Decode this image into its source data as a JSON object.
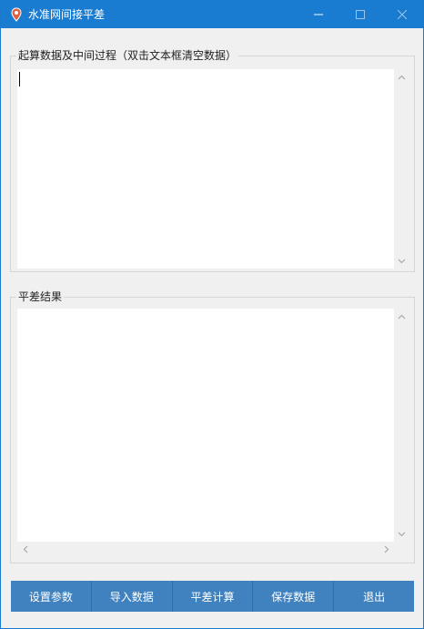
{
  "window": {
    "title": "水准网间接平差"
  },
  "groups": {
    "process": {
      "label": "起算数据及中间过程（双击文本框清空数据）",
      "content": ""
    },
    "result": {
      "label": "平差结果",
      "content": ""
    }
  },
  "buttons": {
    "settings": "设置参数",
    "import": "导入数据",
    "compute": "平差计算",
    "save": "保存数据",
    "exit": "退出"
  },
  "colors": {
    "titlebar": "#1a7cd0",
    "button": "#3f82bf",
    "icon": "#e06040"
  }
}
